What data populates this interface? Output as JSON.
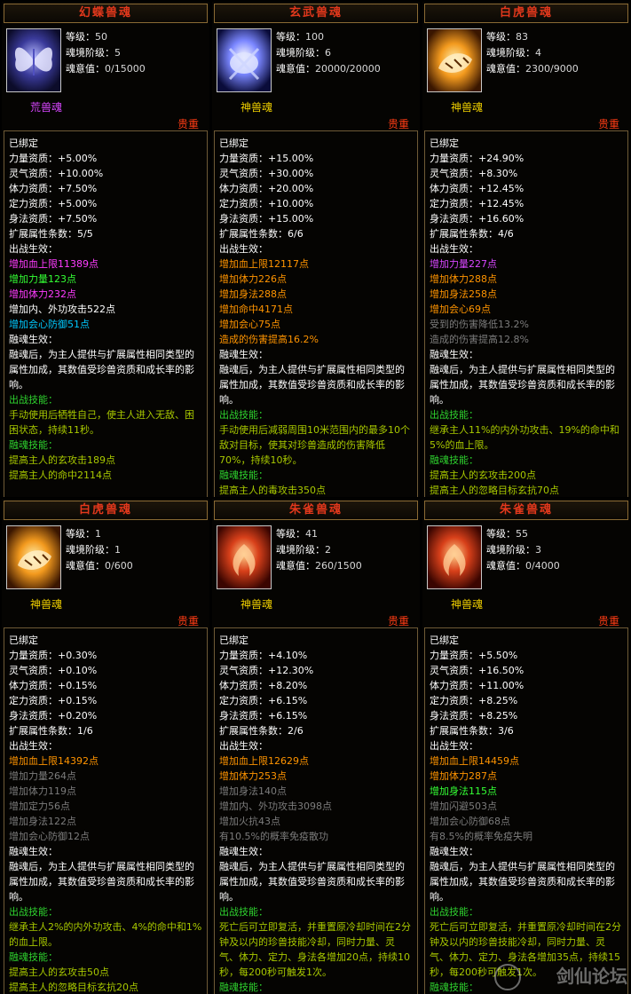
{
  "labels": {
    "level": "等级：",
    "realm": "魂境阶级：",
    "mind": "魂意值：",
    "quality": "贵重"
  },
  "cards": [
    {
      "name": "幻蝶兽魂",
      "icon": "butterfly-icon",
      "level": "50",
      "realm": "5",
      "mind": "0/15000",
      "type": "荒兽魂",
      "type_color": "#d846ff",
      "lines": [
        {
          "t": "已绑定",
          "c": "c-w"
        },
        {
          "t": "力量资质：+5.00%",
          "c": "c-w"
        },
        {
          "t": "灵气资质：+10.00%",
          "c": "c-w"
        },
        {
          "t": "体力资质：+7.50%",
          "c": "c-w"
        },
        {
          "t": "定力资质：+5.00%",
          "c": "c-w"
        },
        {
          "t": "身法资质：+7.50%",
          "c": "c-w"
        },
        {
          "t": "扩展属性条数：5/5",
          "c": "c-w"
        },
        {
          "t": "出战生效：",
          "c": "c-w"
        },
        {
          "t": "增加血上限11389点",
          "c": "c-pink"
        },
        {
          "t": "增加力量123点",
          "c": "c-green"
        },
        {
          "t": "增加体力232点",
          "c": "c-pink"
        },
        {
          "t": "增加内、外功攻击522点",
          "c": "c-w"
        },
        {
          "t": "增加会心防御51点",
          "c": "c-cyan"
        },
        {
          "t": "融魂生效：",
          "c": "c-w"
        },
        {
          "t": "融魂后，为主人提供与扩展属性相同类型的属性加成，其数值受珍兽资质和成长率的影响。",
          "c": "c-w",
          "wrap": true
        },
        {
          "t": "出战技能：",
          "c": "c-dg"
        },
        {
          "t": "手动使用后牺牲自己，使主人进入无敌、困困状态，持续11秒。",
          "c": "c-yg",
          "wrap": true
        },
        {
          "t": "融魂技能：",
          "c": "c-dg"
        },
        {
          "t": "提高主人的玄攻击189点",
          "c": "c-yg"
        },
        {
          "t": "提高主人的命中2114点",
          "c": "c-yg"
        }
      ]
    },
    {
      "name": "玄武兽魂",
      "icon": "turtle-icon",
      "level": "100",
      "realm": "6",
      "mind": "20000/20000",
      "type": "神兽魂",
      "type_color": "#f0d000",
      "lines": [
        {
          "t": "已绑定",
          "c": "c-w"
        },
        {
          "t": "力量资质：+15.00%",
          "c": "c-w"
        },
        {
          "t": "灵气资质：+30.00%",
          "c": "c-w"
        },
        {
          "t": "体力资质：+20.00%",
          "c": "c-w"
        },
        {
          "t": "定力资质：+10.00%",
          "c": "c-w"
        },
        {
          "t": "身法资质：+15.00%",
          "c": "c-w"
        },
        {
          "t": "扩展属性条数：6/6",
          "c": "c-w"
        },
        {
          "t": "出战生效：",
          "c": "c-w"
        },
        {
          "t": "增加血上限12117点",
          "c": "c-orange"
        },
        {
          "t": "增加体力226点",
          "c": "c-orange"
        },
        {
          "t": "增加身法288点",
          "c": "c-orange"
        },
        {
          "t": "增加命中4171点",
          "c": "c-orange"
        },
        {
          "t": "增加会心75点",
          "c": "c-orange"
        },
        {
          "t": "造成的伤害提高16.2%",
          "c": "c-orange"
        },
        {
          "t": "融魂生效：",
          "c": "c-w"
        },
        {
          "t": "融魂后，为主人提供与扩展属性相同类型的属性加成，其数值受珍兽资质和成长率的影响。",
          "c": "c-w",
          "wrap": true
        },
        {
          "t": "出战技能：",
          "c": "c-dg"
        },
        {
          "t": "手动使用后减弱周围10米范围内的最多10个敌对目标，使其对珍兽造成的伤害降低70%，持续10秒。",
          "c": "c-yg",
          "wrap": true
        },
        {
          "t": "融魂技能：",
          "c": "c-dg"
        },
        {
          "t": "提高主人的毒攻击350点",
          "c": "c-yg"
        }
      ]
    },
    {
      "name": "白虎兽魂",
      "icon": "tiger-icon",
      "level": "83",
      "realm": "4",
      "mind": "2300/9000",
      "type": "神兽魂",
      "type_color": "#f0d000",
      "lines": [
        {
          "t": "已绑定",
          "c": "c-w"
        },
        {
          "t": "力量资质：+24.90%",
          "c": "c-w"
        },
        {
          "t": "灵气资质：+8.30%",
          "c": "c-w"
        },
        {
          "t": "体力资质：+12.45%",
          "c": "c-w"
        },
        {
          "t": "定力资质：+12.45%",
          "c": "c-w"
        },
        {
          "t": "身法资质：+16.60%",
          "c": "c-w"
        },
        {
          "t": "扩展属性条数：4/6",
          "c": "c-w"
        },
        {
          "t": "出战生效：",
          "c": "c-w"
        },
        {
          "t": "增加力量227点",
          "c": "c-purple"
        },
        {
          "t": "增加体力288点",
          "c": "c-orange"
        },
        {
          "t": "增加身法258点",
          "c": "c-orange"
        },
        {
          "t": "增加会心69点",
          "c": "c-orange"
        },
        {
          "t": "受到的伤害降低13.2%",
          "c": "c-gray"
        },
        {
          "t": "造成的伤害提高12.8%",
          "c": "c-gray"
        },
        {
          "t": "融魂生效：",
          "c": "c-w"
        },
        {
          "t": "融魂后，为主人提供与扩展属性相同类型的属性加成，其数值受珍兽资质和成长率的影响。",
          "c": "c-w",
          "wrap": true
        },
        {
          "t": "出战技能：",
          "c": "c-dg"
        },
        {
          "t": "继承主人11%的内外功攻击、19%的命中和5%的血上限。",
          "c": "c-yg",
          "wrap": true
        },
        {
          "t": "融魂技能：",
          "c": "c-dg"
        },
        {
          "t": "提高主人的玄攻击200点",
          "c": "c-yg"
        },
        {
          "t": "提高主人的忽略目标玄抗70点",
          "c": "c-yg"
        }
      ]
    },
    {
      "name": "白虎兽魂",
      "icon": "tiger-icon",
      "level": "1",
      "realm": "1",
      "mind": "0/600",
      "type": "神兽魂",
      "type_color": "#f0d000",
      "lines": [
        {
          "t": "已绑定",
          "c": "c-w"
        },
        {
          "t": "力量资质：+0.30%",
          "c": "c-w"
        },
        {
          "t": "灵气资质：+0.10%",
          "c": "c-w"
        },
        {
          "t": "体力资质：+0.15%",
          "c": "c-w"
        },
        {
          "t": "定力资质：+0.15%",
          "c": "c-w"
        },
        {
          "t": "身法资质：+0.20%",
          "c": "c-w"
        },
        {
          "t": "扩展属性条数：1/6",
          "c": "c-w"
        },
        {
          "t": "出战生效：",
          "c": "c-w"
        },
        {
          "t": "增加血上限14392点",
          "c": "c-orange"
        },
        {
          "t": "增加力量264点",
          "c": "c-gray"
        },
        {
          "t": "增加体力119点",
          "c": "c-gray"
        },
        {
          "t": "增加定力56点",
          "c": "c-gray"
        },
        {
          "t": "增加身法122点",
          "c": "c-gray"
        },
        {
          "t": "增加会心防御12点",
          "c": "c-gray"
        },
        {
          "t": "融魂生效：",
          "c": "c-w"
        },
        {
          "t": "融魂后，为主人提供与扩展属性相同类型的属性加成，其数值受珍兽资质和成长率的影响。",
          "c": "c-w",
          "wrap": true
        },
        {
          "t": "出战技能：",
          "c": "c-dg"
        },
        {
          "t": "继承主人2%的内外功攻击、4%的命中和1%的血上限。",
          "c": "c-yg",
          "wrap": true
        },
        {
          "t": "融魂技能：",
          "c": "c-dg"
        },
        {
          "t": "提高主人的玄攻击50点",
          "c": "c-yg"
        },
        {
          "t": "提高主人的忽略目标玄抗20点",
          "c": "c-yg"
        }
      ]
    },
    {
      "name": "朱雀兽魂",
      "icon": "phoenix-icon",
      "level": "41",
      "realm": "2",
      "mind": "260/1500",
      "type": "神兽魂",
      "type_color": "#f0d000",
      "lines": [
        {
          "t": "已绑定",
          "c": "c-w"
        },
        {
          "t": "力量资质：+4.10%",
          "c": "c-w"
        },
        {
          "t": "灵气资质：+12.30%",
          "c": "c-w"
        },
        {
          "t": "体力资质：+8.20%",
          "c": "c-w"
        },
        {
          "t": "定力资质：+6.15%",
          "c": "c-w"
        },
        {
          "t": "身法资质：+6.15%",
          "c": "c-w"
        },
        {
          "t": "扩展属性条数：2/6",
          "c": "c-w"
        },
        {
          "t": "出战生效：",
          "c": "c-w"
        },
        {
          "t": "增加血上限12629点",
          "c": "c-orange"
        },
        {
          "t": "增加体力253点",
          "c": "c-orange"
        },
        {
          "t": "增加身法140点",
          "c": "c-gray"
        },
        {
          "t": "增加内、外功攻击3098点",
          "c": "c-gray"
        },
        {
          "t": "增加火抗43点",
          "c": "c-gray"
        },
        {
          "t": "有10.5%的概率免疫散功",
          "c": "c-gray"
        },
        {
          "t": "融魂生效：",
          "c": "c-w"
        },
        {
          "t": "融魂后，为主人提供与扩展属性相同类型的属性加成，其数值受珍兽资质和成长率的影响。",
          "c": "c-w",
          "wrap": true
        },
        {
          "t": "出战技能：",
          "c": "c-dg"
        },
        {
          "t": "死亡后可立即复活，并重置原冷却时间在2分钟及以内的珍兽技能冷却，同时力量、灵气、体力、定力、身法各增加20点，持续10秒，每200秒可触发1次。",
          "c": "c-yg",
          "wrap": true
        },
        {
          "t": "融魂技能：",
          "c": "c-dg"
        }
      ]
    },
    {
      "name": "朱雀兽魂",
      "icon": "phoenix-icon",
      "level": "55",
      "realm": "3",
      "mind": "0/4000",
      "type": "神兽魂",
      "type_color": "#f0d000",
      "lines": [
        {
          "t": "已绑定",
          "c": "c-w"
        },
        {
          "t": "力量资质：+5.50%",
          "c": "c-w"
        },
        {
          "t": "灵气资质：+16.50%",
          "c": "c-w"
        },
        {
          "t": "体力资质：+11.00%",
          "c": "c-w"
        },
        {
          "t": "定力资质：+8.25%",
          "c": "c-w"
        },
        {
          "t": "身法资质：+8.25%",
          "c": "c-w"
        },
        {
          "t": "扩展属性条数：3/6",
          "c": "c-w"
        },
        {
          "t": "出战生效：",
          "c": "c-w"
        },
        {
          "t": "增加血上限14459点",
          "c": "c-orange"
        },
        {
          "t": "增加体力287点",
          "c": "c-orange"
        },
        {
          "t": "增加身法115点",
          "c": "c-green"
        },
        {
          "t": "增加闪避503点",
          "c": "c-gray"
        },
        {
          "t": "增加会心防御68点",
          "c": "c-gray"
        },
        {
          "t": "有8.5%的概率免疫失明",
          "c": "c-gray"
        },
        {
          "t": "融魂生效：",
          "c": "c-w"
        },
        {
          "t": "融魂后，为主人提供与扩展属性相同类型的属性加成，其数值受珍兽资质和成长率的影响。",
          "c": "c-w",
          "wrap": true
        },
        {
          "t": "出战技能：",
          "c": "c-dg"
        },
        {
          "t": "死亡后可立即复活，并重置原冷却时间在2分钟及以内的珍兽技能冷却，同时力量、灵气、体力、定力、身法各增加35点，持续15秒，每200秒可触发1次。",
          "c": "c-yg",
          "wrap": true
        },
        {
          "t": "融魂技能：",
          "c": "c-dg"
        }
      ]
    }
  ],
  "watermark": {
    "text": "剑仙论坛"
  }
}
